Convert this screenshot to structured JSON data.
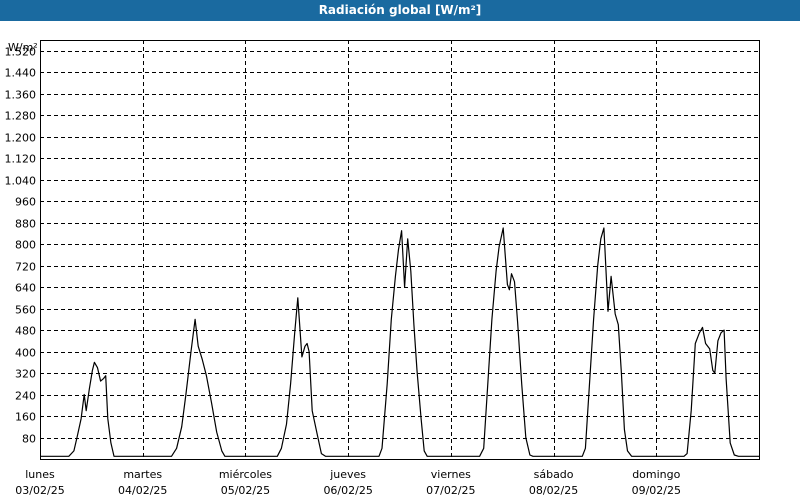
{
  "title": "Radiación global [W/m²]",
  "chart_data": {
    "type": "line",
    "title": "Radiación global [W/m²]",
    "ylabel": "W/m²",
    "xlabel": "",
    "ylim": [
      0,
      1560
    ],
    "xlim": [
      0,
      7
    ],
    "yticks": [
      {
        "value": 80,
        "label": "80"
      },
      {
        "value": 160,
        "label": "160"
      },
      {
        "value": 240,
        "label": "240"
      },
      {
        "value": 320,
        "label": "320"
      },
      {
        "value": 400,
        "label": "400"
      },
      {
        "value": 480,
        "label": "480"
      },
      {
        "value": 560,
        "label": "560"
      },
      {
        "value": 640,
        "label": "640"
      },
      {
        "value": 720,
        "label": "720"
      },
      {
        "value": 800,
        "label": "800"
      },
      {
        "value": 880,
        "label": "880"
      },
      {
        "value": 960,
        "label": "960"
      },
      {
        "value": 1040,
        "label": "1.040"
      },
      {
        "value": 1120,
        "label": "1.120"
      },
      {
        "value": 1200,
        "label": "1.200"
      },
      {
        "value": 1280,
        "label": "1.280"
      },
      {
        "value": 1360,
        "label": "1.360"
      },
      {
        "value": 1440,
        "label": "1.440"
      },
      {
        "value": 1520,
        "label": "1.520"
      }
    ],
    "days": [
      {
        "day": "lunes",
        "date": "03/02/25"
      },
      {
        "day": "martes",
        "date": "04/02/25"
      },
      {
        "day": "miércoles",
        "date": "05/02/25"
      },
      {
        "day": "jueves",
        "date": "06/02/25"
      },
      {
        "day": "viernes",
        "date": "07/02/25"
      },
      {
        "day": "sábado",
        "date": "08/02/25"
      },
      {
        "day": "domingo",
        "date": "09/02/25"
      }
    ],
    "grid": true,
    "series": [
      {
        "color": "#000000",
        "points": [
          [
            0.0,
            10
          ],
          [
            0.28,
            10
          ],
          [
            0.33,
            30
          ],
          [
            0.36,
            80
          ],
          [
            0.4,
            150
          ],
          [
            0.43,
            240
          ],
          [
            0.45,
            180
          ],
          [
            0.48,
            260
          ],
          [
            0.51,
            330
          ],
          [
            0.53,
            360
          ],
          [
            0.56,
            340
          ],
          [
            0.59,
            290
          ],
          [
            0.62,
            300
          ],
          [
            0.64,
            310
          ],
          [
            0.66,
            150
          ],
          [
            0.69,
            60
          ],
          [
            0.72,
            10
          ],
          [
            1.28,
            10
          ],
          [
            1.33,
            40
          ],
          [
            1.38,
            120
          ],
          [
            1.42,
            240
          ],
          [
            1.47,
            400
          ],
          [
            1.51,
            520
          ],
          [
            1.54,
            420
          ],
          [
            1.58,
            370
          ],
          [
            1.62,
            310
          ],
          [
            1.67,
            210
          ],
          [
            1.72,
            100
          ],
          [
            1.77,
            30
          ],
          [
            1.8,
            10
          ],
          [
            2.31,
            10
          ],
          [
            2.35,
            40
          ],
          [
            2.4,
            130
          ],
          [
            2.44,
            280
          ],
          [
            2.48,
            470
          ],
          [
            2.51,
            600
          ],
          [
            2.55,
            380
          ],
          [
            2.58,
            420
          ],
          [
            2.6,
            430
          ],
          [
            2.62,
            400
          ],
          [
            2.65,
            180
          ],
          [
            2.7,
            90
          ],
          [
            2.74,
            20
          ],
          [
            2.78,
            10
          ],
          [
            3.3,
            10
          ],
          [
            3.33,
            40
          ],
          [
            3.38,
            280
          ],
          [
            3.42,
            520
          ],
          [
            3.46,
            680
          ],
          [
            3.49,
            780
          ],
          [
            3.52,
            850
          ],
          [
            3.55,
            640
          ],
          [
            3.58,
            820
          ],
          [
            3.61,
            700
          ],
          [
            3.64,
            500
          ],
          [
            3.67,
            330
          ],
          [
            3.71,
            150
          ],
          [
            3.74,
            30
          ],
          [
            3.77,
            10
          ],
          [
            4.28,
            10
          ],
          [
            4.32,
            40
          ],
          [
            4.36,
            280
          ],
          [
            4.4,
            520
          ],
          [
            4.44,
            700
          ],
          [
            4.47,
            790
          ],
          [
            4.51,
            860
          ],
          [
            4.55,
            650
          ],
          [
            4.57,
            630
          ],
          [
            4.59,
            690
          ],
          [
            4.62,
            660
          ],
          [
            4.65,
            510
          ],
          [
            4.69,
            280
          ],
          [
            4.73,
            80
          ],
          [
            4.77,
            15
          ],
          [
            4.8,
            10
          ],
          [
            5.28,
            10
          ],
          [
            5.31,
            40
          ],
          [
            5.35,
            280
          ],
          [
            5.39,
            520
          ],
          [
            5.43,
            720
          ],
          [
            5.46,
            820
          ],
          [
            5.49,
            860
          ],
          [
            5.53,
            550
          ],
          [
            5.56,
            680
          ],
          [
            5.6,
            540
          ],
          [
            5.63,
            500
          ],
          [
            5.66,
            320
          ],
          [
            5.69,
            110
          ],
          [
            5.72,
            30
          ],
          [
            5.76,
            10
          ],
          [
            6.27,
            10
          ],
          [
            6.3,
            20
          ],
          [
            6.34,
            180
          ],
          [
            6.38,
            430
          ],
          [
            6.42,
            470
          ],
          [
            6.45,
            490
          ],
          [
            6.48,
            430
          ],
          [
            6.52,
            410
          ],
          [
            6.55,
            330
          ],
          [
            6.57,
            320
          ],
          [
            6.6,
            440
          ],
          [
            6.63,
            470
          ],
          [
            6.66,
            480
          ],
          [
            6.68,
            300
          ],
          [
            6.72,
            60
          ],
          [
            6.76,
            15
          ],
          [
            6.8,
            10
          ],
          [
            7.0,
            10
          ]
        ]
      }
    ]
  }
}
